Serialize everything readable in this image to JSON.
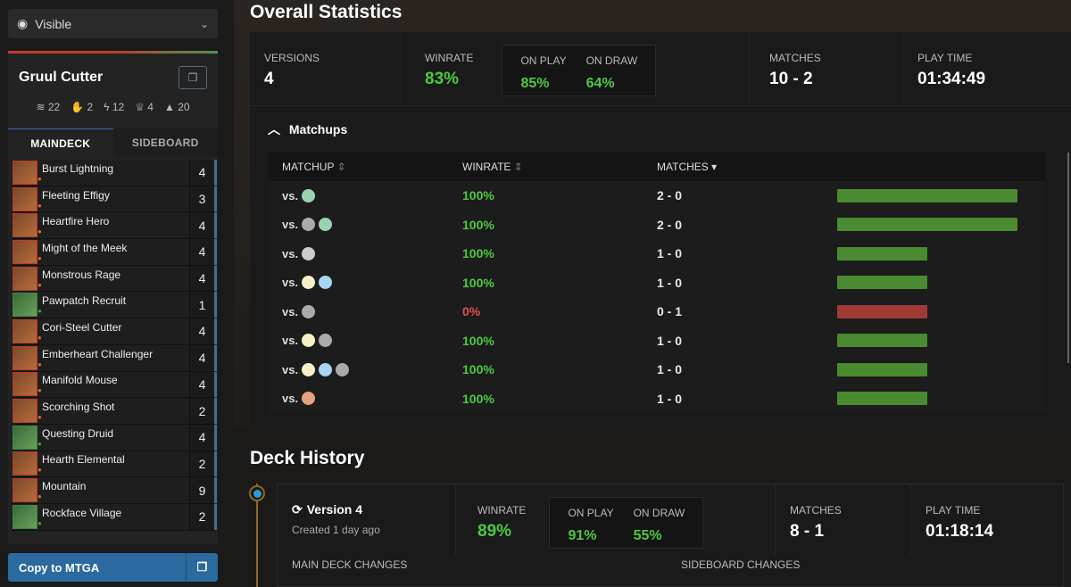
{
  "visibility": {
    "label": "Visible"
  },
  "deck": {
    "title": "Gruul Cutter",
    "stats": [
      "22",
      "2",
      "12",
      "4",
      "20"
    ],
    "tabs": [
      "MAINDECK",
      "SIDEBOARD"
    ],
    "cards": [
      {
        "name": "Burst Lightning",
        "qty": "4",
        "c": "r"
      },
      {
        "name": "Fleeting Effigy",
        "qty": "3",
        "c": "r"
      },
      {
        "name": "Heartfire Hero",
        "qty": "4",
        "c": "r"
      },
      {
        "name": "Might of the Meek",
        "qty": "4",
        "c": "r"
      },
      {
        "name": "Monstrous Rage",
        "qty": "4",
        "c": "r"
      },
      {
        "name": "Pawpatch Recruit",
        "qty": "1",
        "c": "g"
      },
      {
        "name": "Cori-Steel Cutter",
        "qty": "4",
        "c": "r"
      },
      {
        "name": "Emberheart Challenger",
        "qty": "4",
        "c": "r"
      },
      {
        "name": "Manifold Mouse",
        "qty": "4",
        "c": "r"
      },
      {
        "name": "Scorching Shot",
        "qty": "2",
        "c": "r"
      },
      {
        "name": "Questing Druid",
        "qty": "4",
        "c": "g"
      },
      {
        "name": "Hearth Elemental",
        "qty": "2",
        "c": "r"
      },
      {
        "name": "Mountain",
        "qty": "9",
        "c": "r"
      },
      {
        "name": "Rockface Village",
        "qty": "2",
        "c": "g"
      }
    ],
    "copy_label": "Copy to MTGA"
  },
  "overall": {
    "title": "Overall Statistics",
    "versions_label": "VERSIONS",
    "versions": "4",
    "winrate_label": "WINRATE",
    "winrate": "83%",
    "onplay_label": "ON PLAY",
    "onplay": "85%",
    "ondraw_label": "ON DRAW",
    "ondraw": "64%",
    "matches_label": "MATCHES",
    "matches": "10 - 2",
    "playtime_label": "PLAY TIME",
    "playtime": "01:34:49"
  },
  "matchups": {
    "title": "Matchups",
    "headers": [
      "MATCHUP",
      "WINRATE",
      "MATCHES"
    ],
    "rows": [
      {
        "colors": [
          "G"
        ],
        "winrate": "100%",
        "matches": "2 - 0",
        "ratio": 1.0,
        "bar": "long"
      },
      {
        "colors": [
          "B",
          "G"
        ],
        "winrate": "100%",
        "matches": "2 - 0",
        "ratio": 1.0,
        "bar": "long"
      },
      {
        "colors": [
          "C"
        ],
        "winrate": "100%",
        "matches": "1 - 0",
        "ratio": 1.0,
        "bar": "short"
      },
      {
        "colors": [
          "W",
          "U"
        ],
        "winrate": "100%",
        "matches": "1 - 0",
        "ratio": 1.0,
        "bar": "short"
      },
      {
        "colors": [
          "B"
        ],
        "winrate": "0%",
        "matches": "0 - 1",
        "ratio": 0.0,
        "bar": "short"
      },
      {
        "colors": [
          "W",
          "B"
        ],
        "winrate": "100%",
        "matches": "1 - 0",
        "ratio": 1.0,
        "bar": "short"
      },
      {
        "colors": [
          "W",
          "U",
          "B"
        ],
        "winrate": "100%",
        "matches": "1 - 0",
        "ratio": 1.0,
        "bar": "short"
      },
      {
        "colors": [
          "R"
        ],
        "winrate": "100%",
        "matches": "1 - 0",
        "ratio": 1.0,
        "bar": "short"
      }
    ]
  },
  "history": {
    "title": "Deck History",
    "version": "Version 4",
    "created": "Created 1 day ago",
    "winrate_label": "WINRATE",
    "winrate": "89%",
    "onplay_label": "ON PLAY",
    "onplay": "91%",
    "ondraw_label": "ON DRAW",
    "ondraw": "55%",
    "matches_label": "MATCHES",
    "matches": "8 - 1",
    "playtime_label": "PLAY TIME",
    "playtime": "01:18:14",
    "main_changes": "MAIN DECK CHANGES",
    "side_changes": "SIDEBOARD CHANGES"
  },
  "colors": {
    "green": "#4ec940",
    "red": "#e05050",
    "bar_green": "#4a8a30",
    "bar_red": "#a03a35",
    "accent": "#2b6a9e"
  }
}
